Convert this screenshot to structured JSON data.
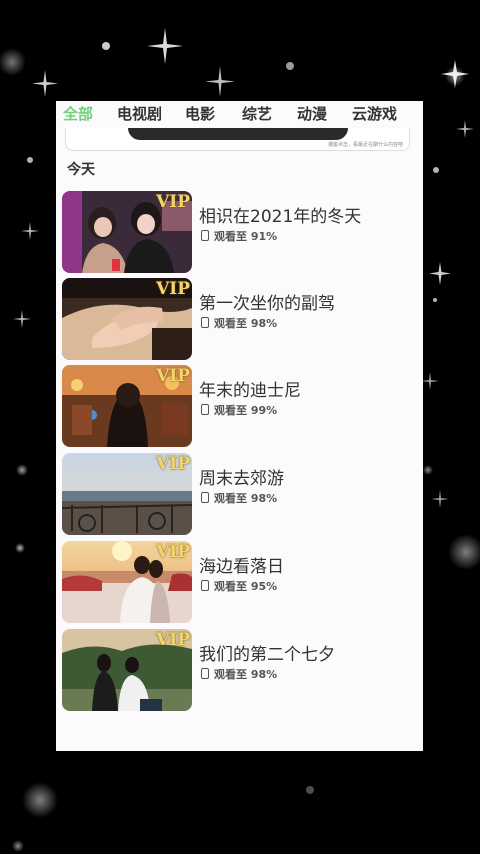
{
  "tabs": [
    {
      "label": "全部",
      "active": true
    },
    {
      "label": "电视剧",
      "active": false
    },
    {
      "label": "电影",
      "active": false
    },
    {
      "label": "综艺",
      "active": false
    },
    {
      "label": "动漫",
      "active": false
    },
    {
      "label": "云游戏",
      "active": false
    }
  ],
  "banner": {
    "note": "播客点击，看最近在聊什么内容吧"
  },
  "section": {
    "title": "今天"
  },
  "history": [
    {
      "title": "相识在2021年的冬天",
      "progress": "观看至 91%",
      "badge": "VIP",
      "icon": "phone-icon"
    },
    {
      "title": "第一次坐你的副驾",
      "progress": "观看至 98%",
      "badge": "VIP",
      "icon": "phone-icon"
    },
    {
      "title": "年末的迪士尼",
      "progress": "观看至 99%",
      "badge": "VIP",
      "icon": "phone-icon"
    },
    {
      "title": "周末去郊游",
      "progress": "观看至 98%",
      "badge": "VIP",
      "icon": "phone-icon"
    },
    {
      "title": "海边看落日",
      "progress": "观看至 95%",
      "badge": "VIP",
      "icon": "phone-icon"
    },
    {
      "title": "我们的第二个七夕",
      "progress": "观看至 98%",
      "badge": "VIP",
      "icon": "phone-icon"
    }
  ],
  "colors": {
    "accent": "#6fd27a",
    "vip": "#f4d56b",
    "background": "#000000",
    "panel": "#fcfafc"
  }
}
